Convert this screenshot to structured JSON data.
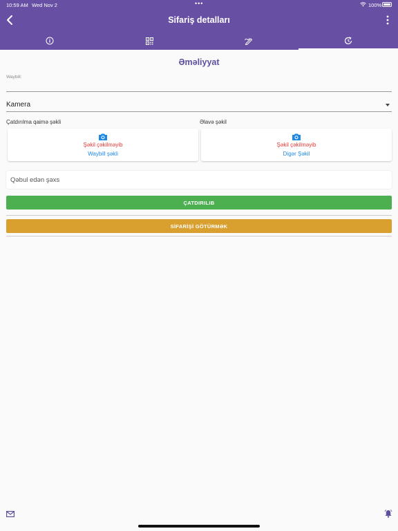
{
  "status_bar": {
    "time": "10:59 AM",
    "date": "Wed Nov 2",
    "dots": "•••",
    "battery": "100%"
  },
  "header": {
    "title": "Sifariş detalları"
  },
  "tabs": [
    {
      "icon": "info-icon"
    },
    {
      "icon": "qr-code-icon"
    },
    {
      "icon": "signature-icon"
    },
    {
      "icon": "history-icon",
      "active": true
    }
  ],
  "section": {
    "title": "Əməliyyat"
  },
  "waybill": {
    "label": "Waybill:",
    "value": ""
  },
  "camera_select": {
    "selected": "Kamera"
  },
  "images": {
    "delivery": {
      "label": "Çatdırılma qaimə şəkli",
      "status": "Şəkil çəkilməyib",
      "action": "Waybill şəkli"
    },
    "extra": {
      "label": "Əlavə şəkil",
      "status": "Şəkil çəkilməyib",
      "action": "Digər Şəkil"
    }
  },
  "receiver": {
    "placeholder": "Qəbul edən şəxs"
  },
  "buttons": {
    "delivered": "ÇATDIRILIB",
    "pickup": "SİFARİŞİ GÖTÜRMƏK"
  },
  "colors": {
    "header": "#6750a4",
    "accent": "#5e4fa0",
    "green": "#4caf50",
    "orange": "#daa02f",
    "error": "#e53935",
    "link": "#1e88e5"
  }
}
